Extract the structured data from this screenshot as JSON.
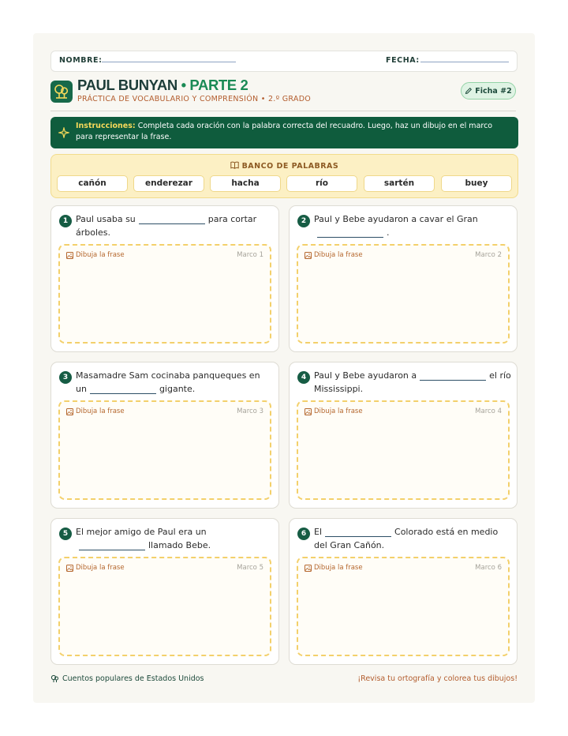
{
  "header": {
    "name_label": "NOMBRE:",
    "date_label": "FECHA:",
    "title_main": "PAUL BUNYAN",
    "title_bullet": "•",
    "title_part": "PARTE 2",
    "subtitle": "PRÁCTICA DE VOCABULARIO Y COMPRENSIÓN • 2.º GRADO",
    "badge": "Ficha #2"
  },
  "instructions": {
    "label": "Instrucciones:",
    "text": "Completa cada oración con la palabra correcta del recuadro. Luego, haz un dibujo en el marco para representar la frase."
  },
  "word_bank": {
    "title": "BANCO DE PALABRAS",
    "words": [
      "cañón",
      "enderezar",
      "hacha",
      "río",
      "sartén",
      "buey"
    ]
  },
  "exercises": [
    {
      "num": "1",
      "before": "Paul usaba su",
      "after": "para cortar árboles.",
      "draw_label": "Dibuja la frase",
      "frame_label": "Marco 1"
    },
    {
      "num": "2",
      "before": "Paul y Bebe ayudaron a cavar el Gran",
      "after": ".",
      "draw_label": "Dibuja la frase",
      "frame_label": "Marco 2"
    },
    {
      "num": "3",
      "before": "Masamadre Sam cocinaba panqueques en un",
      "after": "gigante.",
      "draw_label": "Dibuja la frase",
      "frame_label": "Marco 3"
    },
    {
      "num": "4",
      "before": "Paul y Bebe ayudaron a",
      "after": "el río Mississippi.",
      "draw_label": "Dibuja la frase",
      "frame_label": "Marco 4"
    },
    {
      "num": "5",
      "before": "El mejor amigo de Paul era un",
      "after": "llamado Bebe.",
      "draw_label": "Dibuja la frase",
      "frame_label": "Marco 5"
    },
    {
      "num": "6",
      "before": "El",
      "after": "Colorado está en medio del Gran Cañón.",
      "draw_label": "Dibuja la frase",
      "frame_label": "Marco 6"
    }
  ],
  "footer": {
    "left": "Cuentos populares de Estados Unidos",
    "right": "¡Revisa tu ortografía y colorea tus dibujos!"
  },
  "colors": {
    "primary_green": "#0f5c3d",
    "accent_green": "#1a8a55",
    "accent_orange": "#b35d2e",
    "bank_yellow": "#fcf0c4",
    "frame_dash": "#f3d06b"
  }
}
